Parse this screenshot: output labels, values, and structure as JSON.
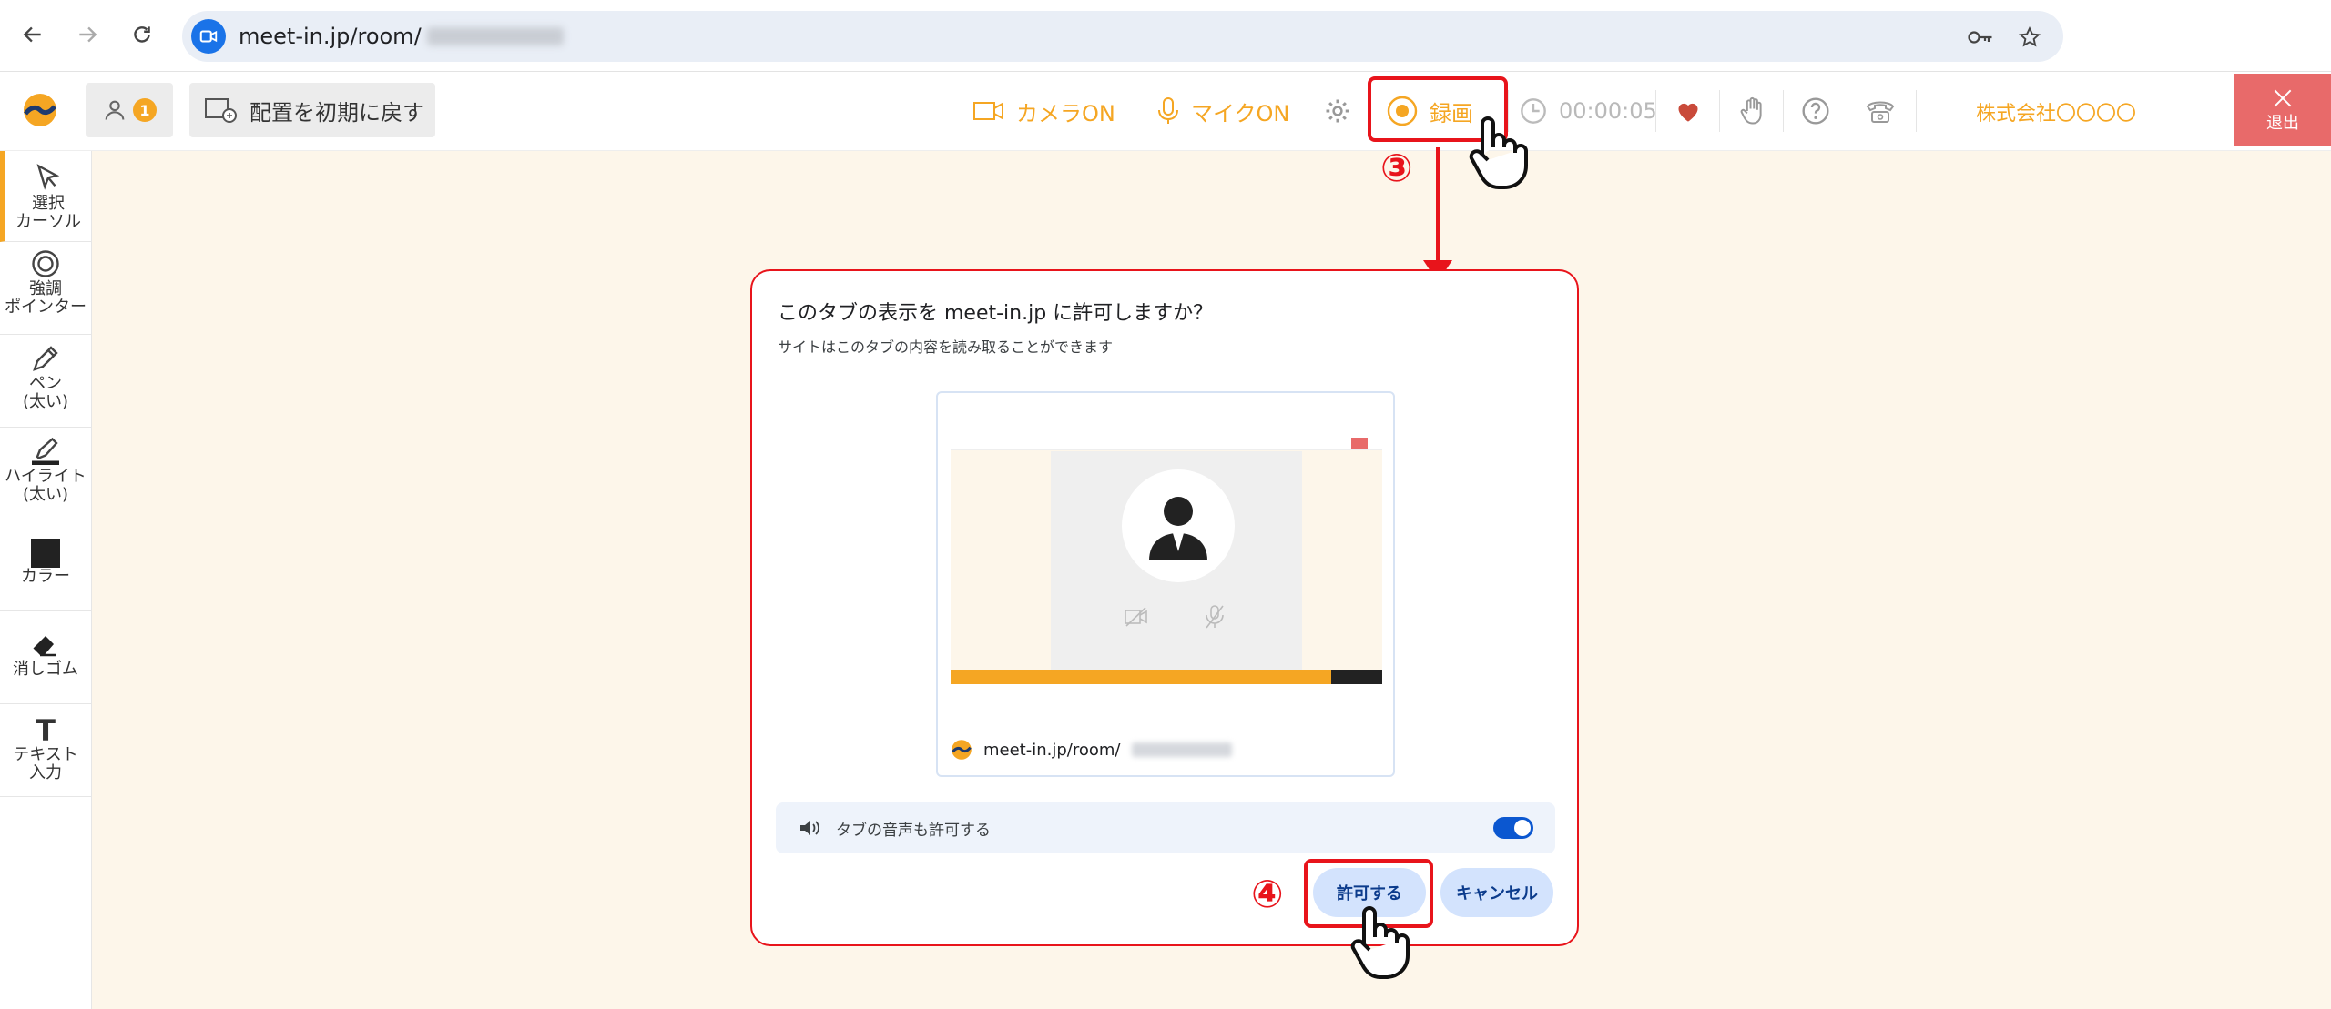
{
  "browser": {
    "url": "meet-in.jp/room/"
  },
  "toolbar": {
    "participant_count": "1",
    "reset_layout_label": "配置を初期に戻す",
    "camera_label": "カメラON",
    "mic_label": "マイクON",
    "record_label": "録画",
    "timer": "00:00:05",
    "company": "株式会社〇〇〇〇",
    "exit_label": "退出"
  },
  "left_tools": [
    {
      "label": "選択\nカーソル",
      "icon": "cursor-icon"
    },
    {
      "label": "強調\nポインター",
      "icon": "pointer-icon"
    },
    {
      "label": "ペン\n(太い)",
      "icon": "pen-icon"
    },
    {
      "label": "ハイライト\n(太い)",
      "icon": "highlighter-icon"
    },
    {
      "label": "カラー",
      "icon": "color-icon"
    },
    {
      "label": "消しゴム",
      "icon": "eraser-icon"
    },
    {
      "label": "テキスト\n入力",
      "icon": "text-icon"
    }
  ],
  "annotations": {
    "step3": "③",
    "step4": "④"
  },
  "dialog": {
    "title": "このタブの表示を meet-in.jp に許可しますか？",
    "subtitle": "サイトはこのタブの内容を読み取ることができます",
    "preview_url": "meet-in.jp/room/",
    "audio_label": "タブの音声も許可する",
    "audio_enabled": true,
    "allow_label": "許可する",
    "cancel_label": "キャンセル"
  },
  "colors": {
    "accent": "#f5a623",
    "annotation": "#e8141b",
    "exit": "#e86a6a",
    "canvas_bg": "#fdf6ea"
  }
}
